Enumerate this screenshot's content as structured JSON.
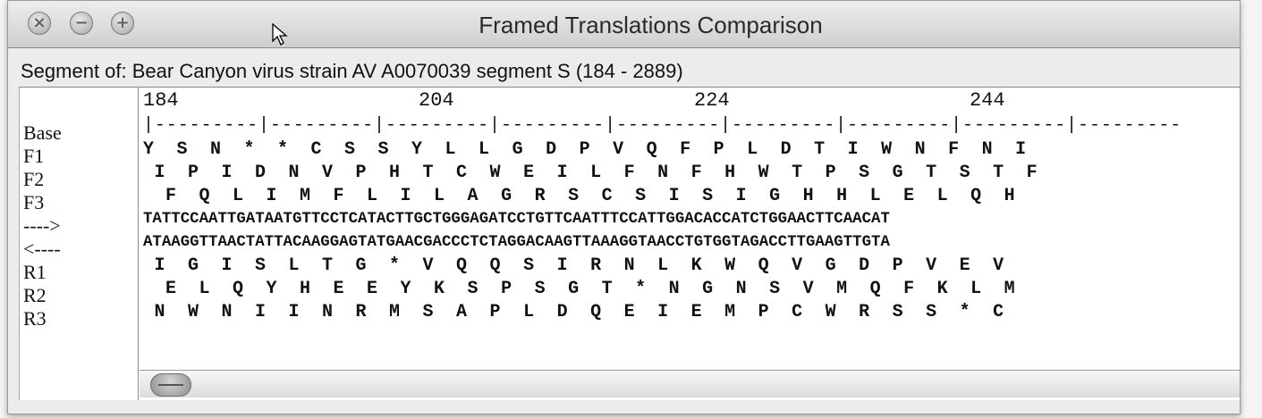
{
  "window": {
    "title": "Framed Translations Comparison"
  },
  "segment": "Segment of: Bear Canyon virus strain AV A0070039 segment S (184 - 2889)",
  "labels": [
    "Base",
    "F1",
    "F2",
    "F3",
    "---->",
    "<----",
    "R1",
    "R2",
    "R3"
  ],
  "ruler": {
    "numbers": [
      "184",
      "204",
      "224",
      "244"
    ],
    "line": "|---------|---------|---------|---------|---------|---------|---------|---------|---------"
  },
  "rows": {
    "F1": "Y  S  N  *  *  C  S  S  Y  L  L  G  D  P  V  Q  F  P  L  D  T  I  W  N  F  N  I",
    "F2": " I  P  I  D  N  V  P  H  T  C  W  E  I  L  F  N  F  H  W  T  P  S  G  T  S  T  F",
    "F3": "  F  Q  L  I  M  F  L  I  L  A  G  R  S  C  S  I  S  I  G  H  H  L  E  L  Q  H",
    "forward": "TATTCCAATTGATAATGTTCCTCATACTTGCTGGGAGATCCTGTTCAATTTCCATTGGACACCATCTGGAACTTCAACAT",
    "reverse": "ATAAGGTTAACTATTACAAGGAGTATGAACGACCCTCTAGGACAAGTTAAAGGTAACCTGTGGTAGACCTTGAAGTTGTA",
    "R1": " I  G  I  S  L  T  G  *  V  Q  Q  S  I  R  N  L  K  W  Q  V  G  D  P  V  E  V",
    "R2": "  E  L  Q  Y  H  E  E  Y  K  S  P  S  G  T  *  N  G  N  S  V  M  Q  F  K  L  M",
    "R3": " N  W  N  I  I  N  R  M  S  A  P  L  D  Q  E  I  E  M  P  C  W  R  S  S  *  C"
  },
  "icons": {
    "close": "close-icon",
    "minimize": "minimize-icon",
    "zoom": "zoom-icon"
  }
}
